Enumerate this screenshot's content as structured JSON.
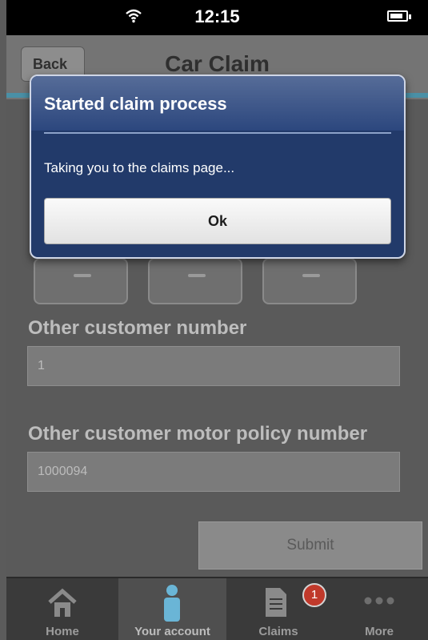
{
  "status_bar": {
    "time": "12:15",
    "wifi_icon": "wifi-icon",
    "battery_icon": "battery-icon"
  },
  "header": {
    "back_label": "Back",
    "title": "Car Claim"
  },
  "form": {
    "other_customer_number_label": "Other customer number",
    "other_customer_number_value": "1",
    "other_policy_label": "Other customer motor policy number",
    "other_policy_value": "1000094",
    "submit_label": "Submit"
  },
  "tabs": [
    {
      "label": "Home",
      "icon": "home-icon"
    },
    {
      "label": "Your account",
      "icon": "user-icon"
    },
    {
      "label": "Claims",
      "icon": "document-icon",
      "badge": "1"
    },
    {
      "label": "More",
      "icon": "more-icon"
    }
  ],
  "modal": {
    "title": "Started claim process",
    "message": "Taking you to the claims page...",
    "ok_label": "Ok"
  },
  "colors": {
    "accent": "#4a90a6",
    "modal_bg": "#223a6a",
    "badge": "#c0392b"
  }
}
